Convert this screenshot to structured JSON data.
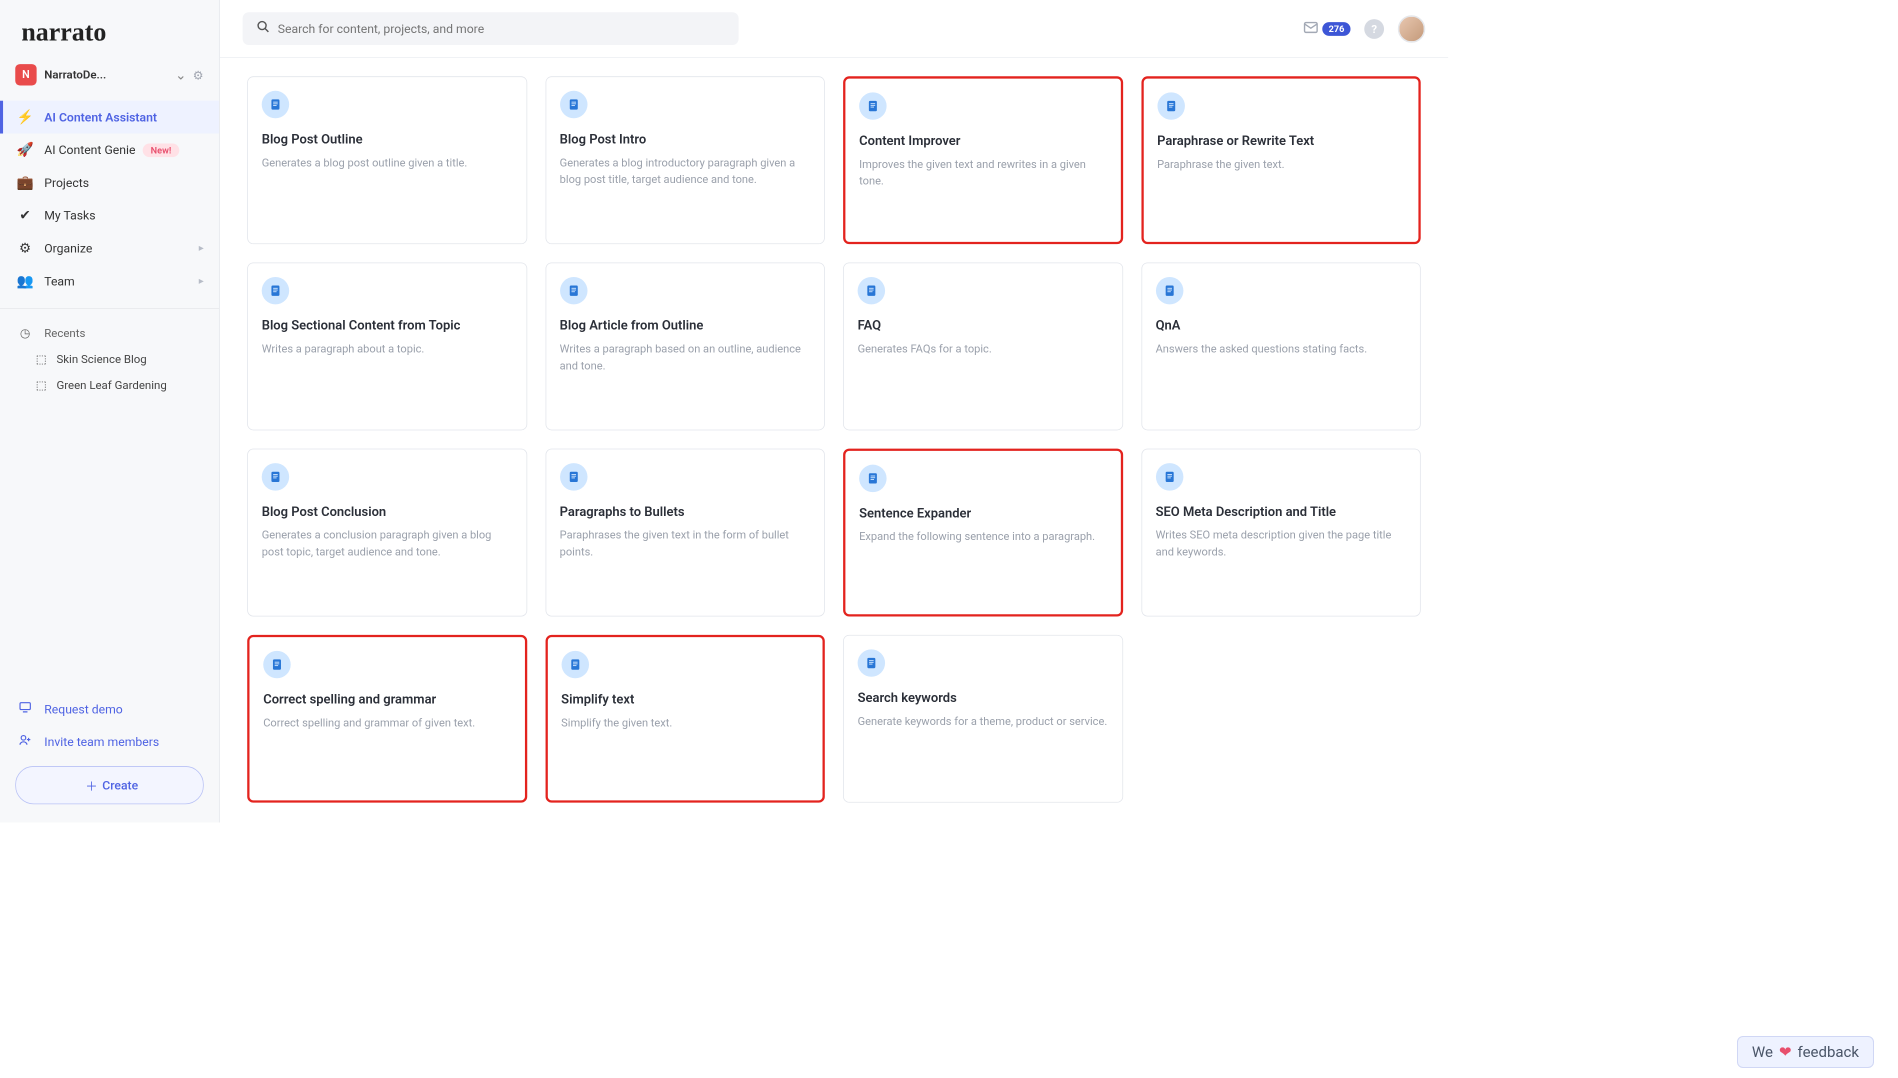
{
  "logo": "narrato",
  "workspace": {
    "initial": "N",
    "name": "NarratoDe..."
  },
  "search": {
    "placeholder": "Search for content, projects, and more"
  },
  "mail_count": "276",
  "nav": [
    {
      "icon": "⚡",
      "label": "AI Content Assistant",
      "active": true
    },
    {
      "icon": "🚀",
      "label": "AI Content Genie",
      "badge": "New!"
    },
    {
      "icon": "💼",
      "label": "Projects"
    },
    {
      "icon": "✔",
      "label": "My Tasks"
    },
    {
      "icon": "⚙",
      "label": "Organize",
      "caret": true
    },
    {
      "icon": "👥",
      "label": "Team",
      "caret": true
    }
  ],
  "recents_label": "Recents",
  "recents": [
    {
      "label": "Skin Science Blog"
    },
    {
      "label": "Green Leaf Gardening"
    }
  ],
  "bottom_links": [
    {
      "icon": "🖵",
      "label": "Request demo"
    },
    {
      "icon": "+👤",
      "label": "Invite team members"
    }
  ],
  "create_label": "Create",
  "feedback_prefix": "We",
  "feedback_suffix": "feedback",
  "cards": [
    {
      "title": "Blog Post Outline",
      "desc": "Generates a blog post outline given a title.",
      "hl": false
    },
    {
      "title": "Blog Post Intro",
      "desc": "Generates a blog introductory paragraph given a blog post title, target audience and tone.",
      "hl": false
    },
    {
      "title": "Content Improver",
      "desc": "Improves the given text and rewrites in a given tone.",
      "hl": true
    },
    {
      "title": "Paraphrase or Rewrite Text",
      "desc": "Paraphrase the given text.",
      "hl": true
    },
    {
      "title": "Blog Sectional Content from Topic",
      "desc": "Writes a paragraph about a topic.",
      "hl": false
    },
    {
      "title": "Blog Article from Outline",
      "desc": "Writes a paragraph based on an outline, audience and tone.",
      "hl": false
    },
    {
      "title": "FAQ",
      "desc": "Generates FAQs for a topic.",
      "hl": false
    },
    {
      "title": "QnA",
      "desc": "Answers the asked questions stating facts.",
      "hl": false
    },
    {
      "title": "Blog Post Conclusion",
      "desc": "Generates a conclusion paragraph given a blog post topic, target audience and tone.",
      "hl": false
    },
    {
      "title": "Paragraphs to Bullets",
      "desc": "Paraphrases the given text in the form of bullet points.",
      "hl": false
    },
    {
      "title": "Sentence Expander",
      "desc": "Expand the following sentence into a paragraph.",
      "hl": true
    },
    {
      "title": "SEO Meta Description and Title",
      "desc": "Writes SEO meta description given the page title and keywords.",
      "hl": false
    },
    {
      "title": "Correct spelling and grammar",
      "desc": "Correct spelling and grammar of given text.",
      "hl": true
    },
    {
      "title": "Simplify text",
      "desc": "Simplify the given text.",
      "hl": true
    },
    {
      "title": "Search keywords",
      "desc": "Generate keywords for a theme, product or service.",
      "hl": false
    }
  ]
}
